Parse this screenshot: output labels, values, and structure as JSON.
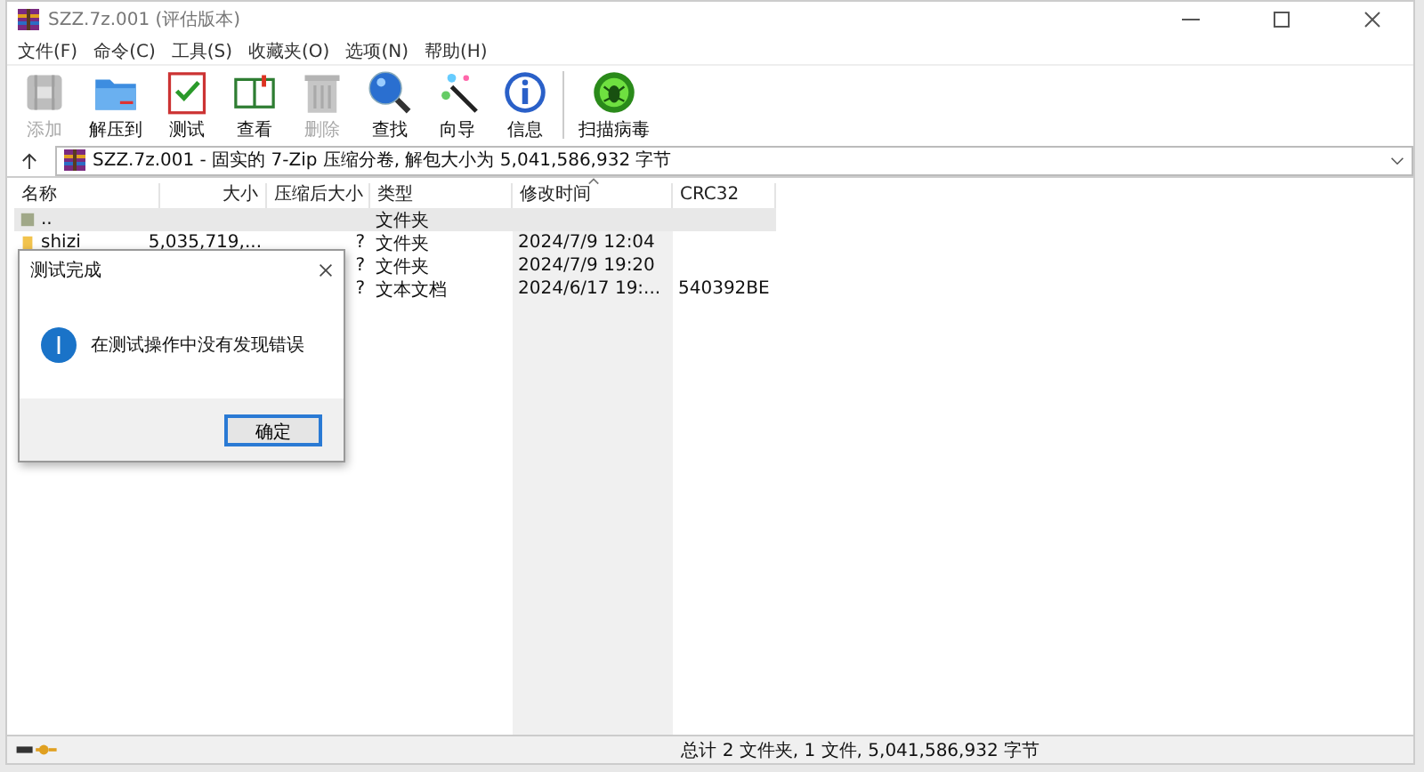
{
  "window": {
    "title": "SZZ.7z.001 (评估版本)"
  },
  "menu": [
    "文件(F)",
    "命令(C)",
    "工具(S)",
    "收藏夹(O)",
    "选项(N)",
    "帮助(H)"
  ],
  "toolbar": [
    {
      "label": "添加",
      "disabled": true
    },
    {
      "label": "解压到",
      "disabled": false
    },
    {
      "label": "测试",
      "disabled": false
    },
    {
      "label": "查看",
      "disabled": false
    },
    {
      "label": "删除",
      "disabled": true
    },
    {
      "label": "查找",
      "disabled": false
    },
    {
      "label": "向导",
      "disabled": false
    },
    {
      "label": "信息",
      "disabled": false
    },
    {
      "label": "扫描病毒",
      "disabled": false
    }
  ],
  "address": "SZZ.7z.001 - 固实的 7-Zip 压缩分卷, 解包大小为 5,041,586,932 字节",
  "columns": [
    {
      "label": "名称",
      "sorted": false
    },
    {
      "label": "大小",
      "sorted": false
    },
    {
      "label": "压缩后大小",
      "sorted": false
    },
    {
      "label": "类型",
      "sorted": false
    },
    {
      "label": "修改时间",
      "sorted": true
    },
    {
      "label": "CRC32",
      "sorted": false
    }
  ],
  "rows": [
    {
      "kind": "parent",
      "selected": true,
      "name": "..",
      "type": "文件夹"
    },
    {
      "kind": "folder",
      "selected": false,
      "name": "shizi",
      "size": "5,035,719,...",
      "packed": "?",
      "type": "文件夹",
      "modified": "2024/7/9 12:04"
    },
    {
      "selected": false,
      "packed": "?",
      "type": "文件夹",
      "modified": "2024/7/9 19:20"
    },
    {
      "selected": false,
      "packed": "?",
      "type": "文本文档",
      "modified": "2024/6/17 19:...",
      "crc": "540392BE"
    }
  ],
  "dialog": {
    "title": "测试完成",
    "message": "在测试操作中没有发现错误",
    "button": "确定"
  },
  "status_bar": "总计 2 文件夹, 1 文件, 5,041,586,932 字节"
}
